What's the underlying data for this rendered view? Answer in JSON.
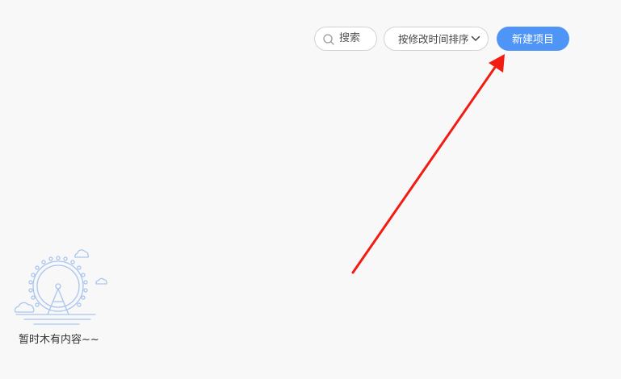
{
  "toolbar": {
    "search_label": "搜索",
    "search_icon": "search-icon",
    "sort_label": "按修改时间排序",
    "sort_icon": "chevron-down-icon",
    "new_project_label": "新建项目"
  },
  "empty_state": {
    "illustration": "ferris-wheel-illustration",
    "message": "暂时木有内容~~"
  },
  "annotation": {
    "arrow_color": "#f21c12"
  },
  "colors": {
    "background": "#f8f8f8",
    "primary": "#4f94f7",
    "illustration_line": "#a9c5ef"
  }
}
